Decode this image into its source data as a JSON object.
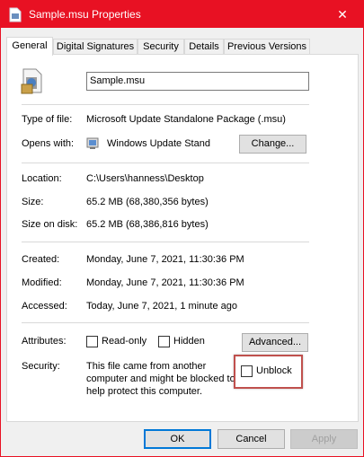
{
  "window": {
    "title": "Sample.msu Properties",
    "close_glyph": "✕",
    "accent_color": "#e81123"
  },
  "tabs": [
    {
      "label": "General"
    },
    {
      "label": "Digital Signatures"
    },
    {
      "label": "Security"
    },
    {
      "label": "Details"
    },
    {
      "label": "Previous Versions"
    }
  ],
  "general": {
    "filename": "Sample.msu",
    "type_label": "Type of file:",
    "type_value": "Microsoft Update Standalone Package (.msu)",
    "opens_label": "Opens with:",
    "opens_value": "Windows Update Stand",
    "change_button": "Change...",
    "location_label": "Location:",
    "location_value": "C:\\Users\\hanness\\Desktop",
    "size_label": "Size:",
    "size_value": "65.2 MB (68,380,356 bytes)",
    "size_disk_label": "Size on disk:",
    "size_disk_value": "65.2 MB (68,386,816 bytes)",
    "created_label": "Created:",
    "created_value": "Monday, June 7, 2021, 11:30:36 PM",
    "modified_label": "Modified:",
    "modified_value": "Monday, June 7, 2021, 11:30:36 PM",
    "accessed_label": "Accessed:",
    "accessed_value": "Today, June 7, 2021, 1 minute ago",
    "attributes_label": "Attributes:",
    "readonly_label": "Read-only",
    "hidden_label": "Hidden",
    "advanced_button": "Advanced...",
    "security_label": "Security:",
    "security_line1": "This file came from another",
    "security_line2": "computer and might be blocked to",
    "security_line3": "help protect this computer.",
    "unblock_label": "Unblock"
  },
  "footer": {
    "ok": "OK",
    "cancel": "Cancel",
    "apply": "Apply"
  }
}
